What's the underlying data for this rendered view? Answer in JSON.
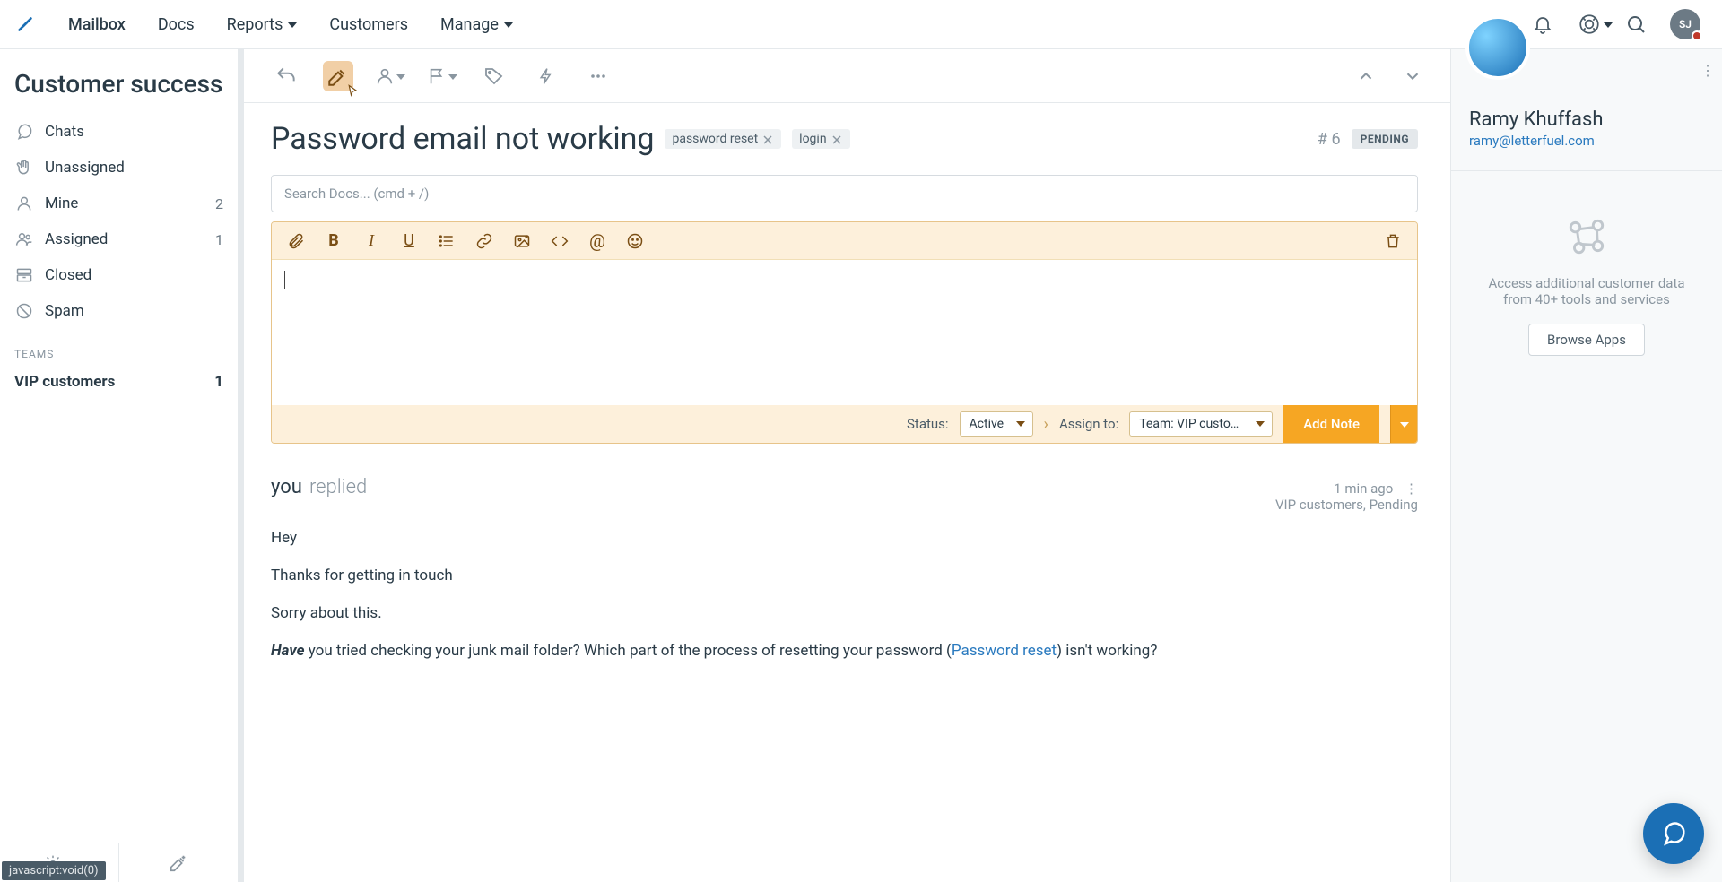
{
  "colors": {
    "accent": "#1b6fb5",
    "note": "#f6a623",
    "noteBg": "#fdf0db"
  },
  "nav": {
    "items": [
      {
        "label": "Mailbox",
        "active": true,
        "caret": false
      },
      {
        "label": "Docs",
        "caret": false
      },
      {
        "label": "Reports",
        "caret": true
      },
      {
        "label": "Customers",
        "caret": false
      },
      {
        "label": "Manage",
        "caret": true
      }
    ],
    "avatarInitials": "SJ"
  },
  "sidebar": {
    "mailboxName": "Customer success",
    "folders": [
      {
        "icon": "chat",
        "label": "Chats",
        "count": ""
      },
      {
        "icon": "hand",
        "label": "Unassigned",
        "count": ""
      },
      {
        "icon": "user",
        "label": "Mine",
        "count": "2"
      },
      {
        "icon": "users",
        "label": "Assigned",
        "count": "1"
      },
      {
        "icon": "drawer",
        "label": "Closed",
        "count": ""
      },
      {
        "icon": "ban",
        "label": "Spam",
        "count": ""
      }
    ],
    "teamsLabel": "TEAMS",
    "teams": [
      {
        "label": "VIP customers",
        "count": "1"
      }
    ]
  },
  "conversation": {
    "title": "Password email not working",
    "tags": [
      "password reset",
      "login"
    ],
    "numberPrefix": "# ",
    "number": "6",
    "statusBadge": "PENDING",
    "search": {
      "placeholder": "Search Docs... (cmd + /)"
    },
    "noteFoot": {
      "statusLabel": "Status:",
      "statusValue": "Active",
      "assignLabel": "Assign to:",
      "assignValue": "Team: VIP customers",
      "addNote": "Add Note"
    }
  },
  "message": {
    "authorYou": "you",
    "action": "replied",
    "timestamp": "1 min ago",
    "metaLine": "VIP customers, Pending",
    "body": {
      "line1": "Hey",
      "line2": "Thanks for getting in touch",
      "line3": "Sorry about this.",
      "haveWord": "Have",
      "line4a": " you tried checking your junk mail folder? Which part of the process of resetting your password (",
      "link": "Password reset",
      "line4b": ") isn't working?"
    }
  },
  "customer": {
    "name": "Ramy Khuffash",
    "email": "ramy@letterfuel.com"
  },
  "apps": {
    "blurb": "Access additional customer data from 40+ tools and services",
    "browse": "Browse Apps"
  },
  "statusLink": "javascript:void(0)"
}
